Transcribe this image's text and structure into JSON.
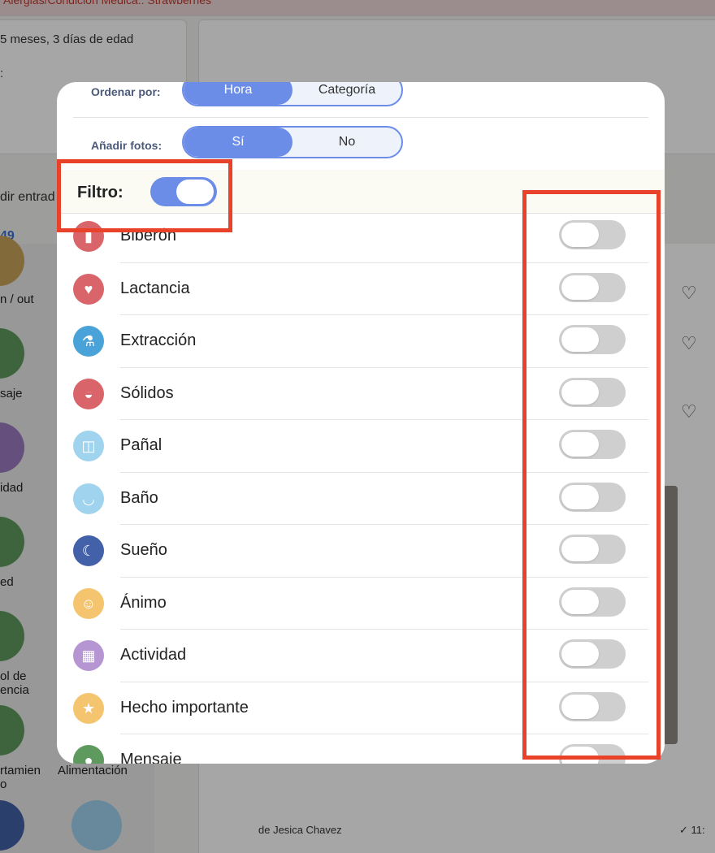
{
  "background": {
    "topbar_text": "Alergias/Condición Médica:: Strawberries",
    "age_text": "5 meses, 3 días de edad",
    "colon_text": ":",
    "add_entry_text": "dir entrad",
    "count_text": "49",
    "side_items": [
      {
        "label": "n / out",
        "color": "#c9a35a"
      },
      {
        "label": "saje",
        "color": "#5e9a5e"
      },
      {
        "label": "idad",
        "color": "#9b7bc0"
      },
      {
        "label": "ed",
        "color": "#5e9a5e"
      },
      {
        "label": "ol de\nencia",
        "color": "#5e9a5e"
      },
      {
        "label": "rtamien\no",
        "color": "#5e9a5e"
      },
      {
        "label": "Alimentación",
        "color": "#5e9a5e"
      }
    ],
    "footer_author": "de Jesica Chavez",
    "footer_time": "✓ 11:"
  },
  "modal": {
    "order_by": {
      "label": "Ordenar por:",
      "options": [
        "Hora",
        "Categoría"
      ],
      "selected": "Hora"
    },
    "add_photos": {
      "label": "Añadir fotos:",
      "options": [
        "Sí",
        "No"
      ],
      "selected": "Sí"
    },
    "filter": {
      "label": "Filtro:",
      "enabled": true
    },
    "items": [
      {
        "label": "Biberón",
        "icon": "bottle-icon",
        "color": "#d9646a",
        "glyph": "▮",
        "enabled": false
      },
      {
        "label": "Lactancia",
        "icon": "breastfeeding-icon",
        "color": "#d9646a",
        "glyph": "♥",
        "enabled": false
      },
      {
        "label": "Extracción",
        "icon": "breast-pump-icon",
        "color": "#4aa3d8",
        "glyph": "⚗",
        "enabled": false
      },
      {
        "label": "Sólidos",
        "icon": "solids-bowl-icon",
        "color": "#d9646a",
        "glyph": "◒",
        "enabled": false
      },
      {
        "label": "Pañal",
        "icon": "diaper-icon",
        "color": "#9fd3ee",
        "glyph": "◫",
        "enabled": false
      },
      {
        "label": "Baño",
        "icon": "bathtub-icon",
        "color": "#9fd3ee",
        "glyph": "◡",
        "enabled": false
      },
      {
        "label": "Sueño",
        "icon": "moon-icon",
        "color": "#4361a8",
        "glyph": "☾",
        "enabled": false
      },
      {
        "label": "Ánimo",
        "icon": "smiley-icon",
        "color": "#f5c46e",
        "glyph": "☺",
        "enabled": false
      },
      {
        "label": "Actividad",
        "icon": "blocks-icon",
        "color": "#b596d3",
        "glyph": "▦",
        "enabled": false
      },
      {
        "label": "Hecho importante",
        "icon": "star-icon",
        "color": "#f5c46e",
        "glyph": "★",
        "enabled": false
      },
      {
        "label": "Mensaje",
        "icon": "message-icon",
        "color": "#5e9a5e",
        "glyph": "●",
        "enabled": false
      }
    ]
  }
}
